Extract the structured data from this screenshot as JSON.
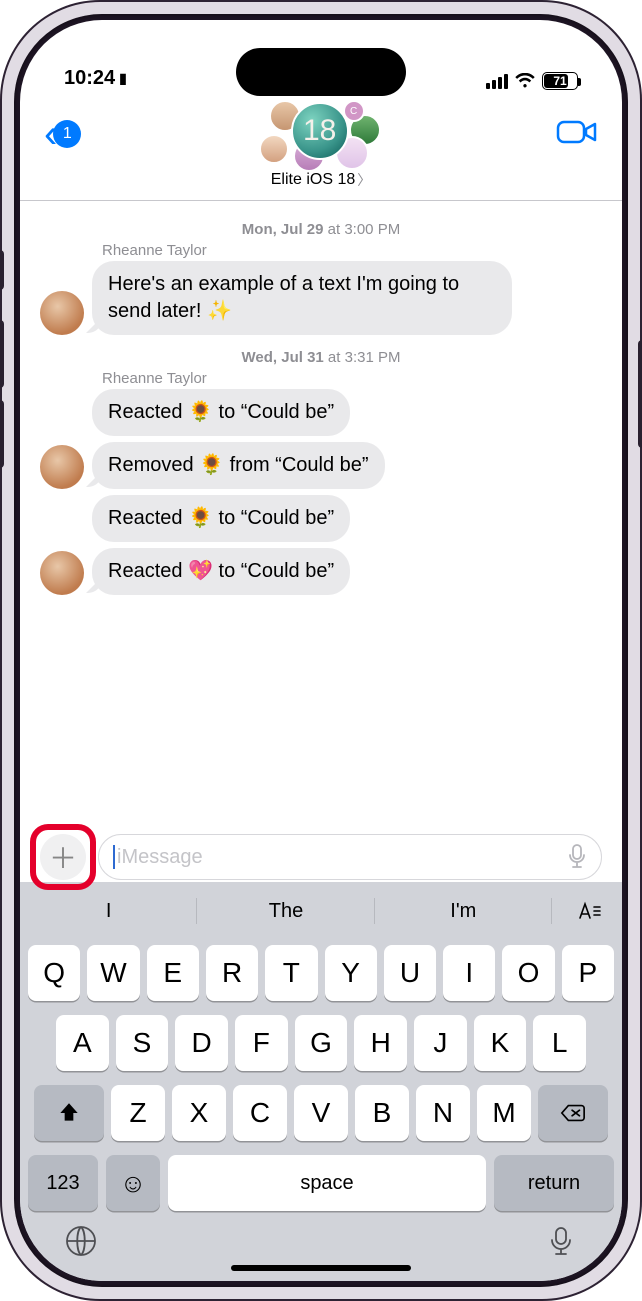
{
  "status": {
    "time": "10:24",
    "battery_pct": "71",
    "focus_icon": "▮"
  },
  "nav": {
    "back_badge": "1",
    "chat_name": "Elite iOS 18",
    "avatar_label": "18",
    "mini_initial": "C"
  },
  "thread": {
    "ts1": {
      "day": "Mon, Jul 29",
      "at": " at ",
      "time": "3:00 PM"
    },
    "sender1": "Rheanne Taylor",
    "msg1": "Here's an example of a text I'm going to send later! ✨",
    "ts2": {
      "day": "Wed, Jul 31",
      "at": " at ",
      "time": "3:31 PM"
    },
    "sender2": "Rheanne Taylor",
    "r1": "Reacted 🌻 to “Could be”",
    "r2": "Removed 🌻 from “Could be”",
    "r3": "Reacted 🌻 to “Could be”",
    "r4": "Reacted 💖 to “Could be”"
  },
  "compose": {
    "placeholder": "iMessage"
  },
  "keyboard": {
    "sug1": "I",
    "sug2": "The",
    "sug3": "I'm",
    "row1": [
      "Q",
      "W",
      "E",
      "R",
      "T",
      "Y",
      "U",
      "I",
      "O",
      "P"
    ],
    "row2": [
      "A",
      "S",
      "D",
      "F",
      "G",
      "H",
      "J",
      "K",
      "L"
    ],
    "row3": [
      "Z",
      "X",
      "C",
      "V",
      "B",
      "N",
      "M"
    ],
    "key123": "123",
    "space": "space",
    "return": "return"
  }
}
